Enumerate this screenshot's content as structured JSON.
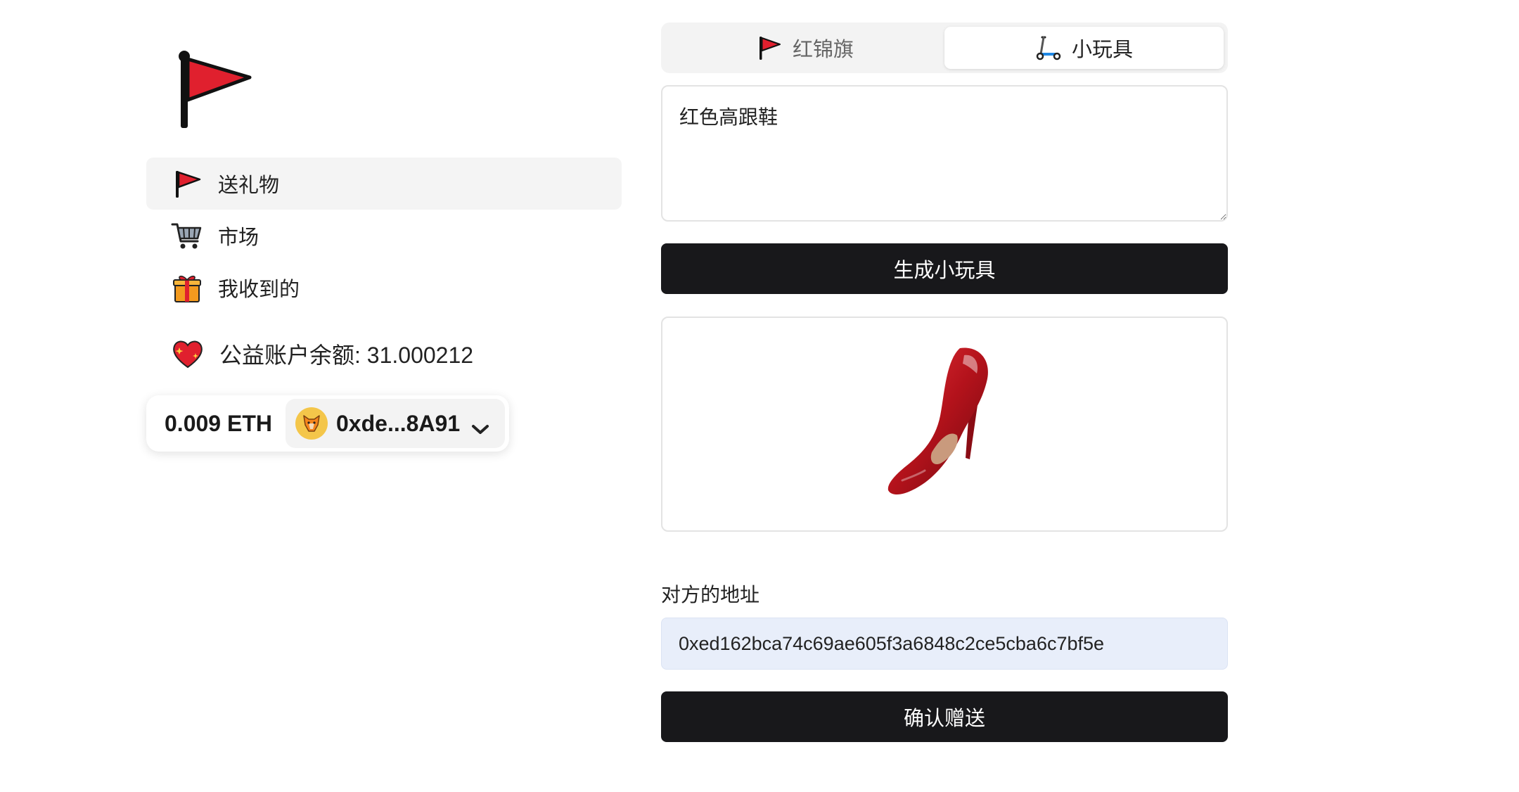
{
  "sidebar": {
    "logo_icon": "red-flag-icon",
    "nav": [
      {
        "label": "送礼物",
        "icon": "red-flag-icon",
        "active": true
      },
      {
        "label": "市场",
        "icon": "shopping-cart-icon",
        "active": false
      },
      {
        "label": "我收到的",
        "icon": "gift-icon",
        "active": false
      }
    ],
    "balance_text": "公益账户余额: 31.000212",
    "balance_icon": "sparkling-heart-icon"
  },
  "wallet": {
    "eth_balance": "0.009 ETH",
    "account": "0xde...8A91",
    "avatar_icon": "metamask-fox-icon"
  },
  "tabs": [
    {
      "label": "红锦旗",
      "icon": "red-flag-icon",
      "active": false
    },
    {
      "label": "小玩具",
      "icon": "scooter-icon",
      "active": true
    }
  ],
  "prompt": {
    "value": "红色高跟鞋"
  },
  "generate_button": "生成小玩具",
  "preview": {
    "subject": "red-high-heel-shoe"
  },
  "address": {
    "label": "对方的地址",
    "value": "0xed162bca74c69ae605f3a6848c2ce5cba6c7bf5e"
  },
  "confirm_button": "确认赠送",
  "colors": {
    "primary_button": "#18181b",
    "accent_red": "#e0202e",
    "input_bg": "#e8eefa"
  }
}
